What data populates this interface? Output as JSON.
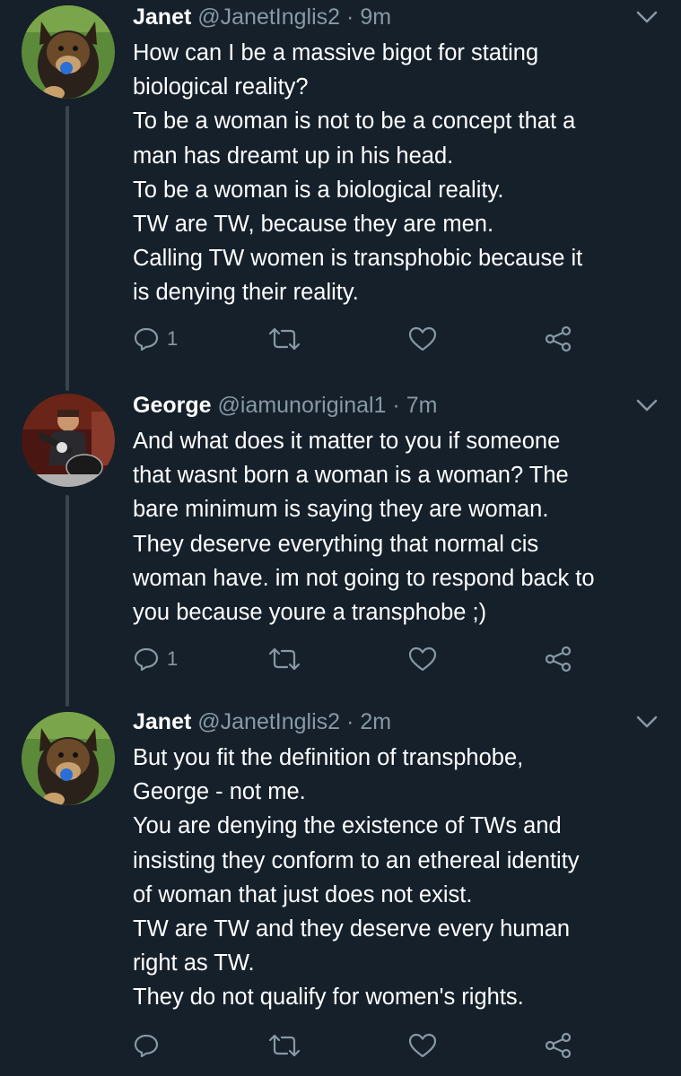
{
  "colors": {
    "background": "#15202b",
    "text": "#ffffff",
    "secondary": "#8899a6",
    "thread_line": "#38444d"
  },
  "tweets": [
    {
      "name": "Janet",
      "handle": "@JanetInglis2",
      "separator": "·",
      "time": "9m",
      "avatar": "dog-avatar",
      "lines": [
        "How can I be a massive bigot for stating",
        "biological reality?",
        "To be a woman is not to be a concept that a",
        "man has dreamt up in his head.",
        "To be a woman is a biological reality.",
        "TW are TW, because they are men.",
        "Calling TW women is transphobic because it",
        "is denying their reality."
      ],
      "reply_count": "1"
    },
    {
      "name": "George",
      "handle": "@iamunoriginal1",
      "separator": "·",
      "time": "7m",
      "avatar": "guitarist-avatar",
      "lines": [
        "And what does it matter to you if someone",
        "that wasnt born a woman is a woman? The",
        "bare minimum is saying they are woman.",
        "They deserve everything that normal cis",
        "woman have. im not going to respond back to",
        "you because youre a transphobe ;)"
      ],
      "reply_count": "1"
    },
    {
      "name": "Janet",
      "handle": "@JanetInglis2",
      "separator": "·",
      "time": "2m",
      "avatar": "dog-avatar",
      "lines": [
        "But you fit the definition of transphobe,",
        "George - not me.",
        "You are denying the existence of TWs and",
        "insisting they conform to an ethereal identity",
        "of woman that just does not exist.",
        "TW are TW and they deserve every human",
        "right as TW.",
        "They do not qualify for women's rights."
      ],
      "reply_count": ""
    }
  ],
  "icons": {
    "reply": "reply-icon",
    "retweet": "retweet-icon",
    "like": "like-icon",
    "share": "share-icon",
    "menu": "chevron-down-icon"
  }
}
